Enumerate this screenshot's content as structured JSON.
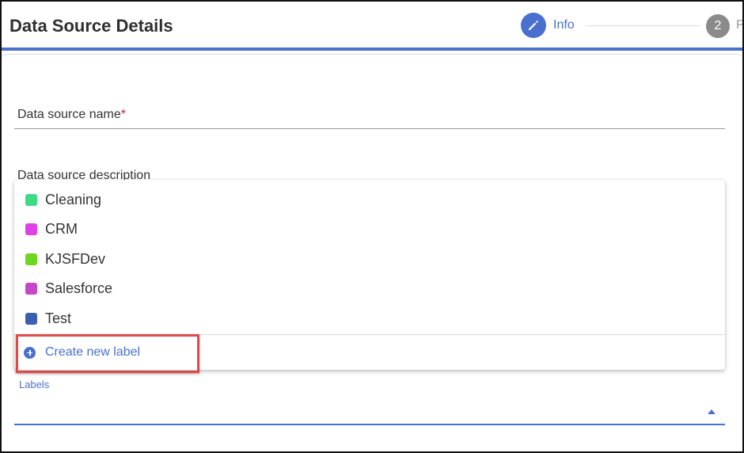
{
  "header": {
    "title": "Data Source Details",
    "steps": [
      {
        "label": "Info",
        "icon": "pencil-icon",
        "state": "active",
        "color": "#4a6fcf"
      },
      {
        "number": "2",
        "label": "P",
        "state": "inactive"
      }
    ]
  },
  "form": {
    "name_label": "Data source name",
    "required_mark": "*",
    "description_label": "Data source description",
    "labels_caption": "Labels"
  },
  "dropdown": {
    "options": [
      {
        "label": "Cleaning",
        "color": "#3ddc84"
      },
      {
        "label": "CRM",
        "color": "#e040e8"
      },
      {
        "label": "KJSFDev",
        "color": "#6fd51f"
      },
      {
        "label": "Salesforce",
        "color": "#c548c8"
      },
      {
        "label": "Test",
        "color": "#3a5fb0"
      }
    ],
    "create_label": "Create new label"
  },
  "colors": {
    "accent": "#4a6fcf",
    "highlight": "#e04a4a",
    "required": "#d11a2a"
  }
}
